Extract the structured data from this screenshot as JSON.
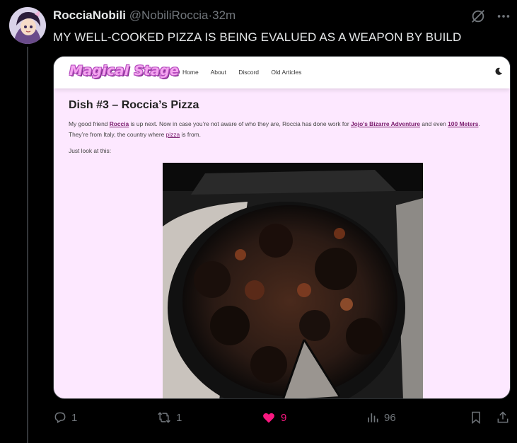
{
  "tweet": {
    "display_name": "RocciaNobili",
    "handle": "@NobiliRoccia",
    "separator": "·",
    "time": "32m",
    "text": "MY WELL-COOKED PIZZA IS BEING EVALUED AS A WEAPON BY BUILD"
  },
  "site": {
    "logo": "Magical Stage",
    "nav": [
      "Home",
      "About",
      "Discord",
      "Old Articles"
    ],
    "article_title": "Dish #3 – Roccia’s Pizza",
    "p1_a": "My good friend ",
    "p1_link1": "Roccia",
    "p1_b": " is up next. Now in case you’re not aware of who they are, Roccia has done work for ",
    "p1_link2": "Jojo’s Bizarre Adventure",
    "p1_c": " and even ",
    "p1_link3": "100 Meters",
    "p1_d": ". They’re from Italy, the country where ",
    "p1_link4": "pizza",
    "p1_e": " is from.",
    "p2": "Just look at this:"
  },
  "actions": {
    "replies": "1",
    "reposts": "1",
    "likes": "9",
    "views": "96"
  },
  "colors": {
    "like": "#f91880",
    "muted": "#71767b",
    "site_bg": "#fde8ff"
  },
  "icons": [
    "grok-icon",
    "more-icon",
    "moon-icon",
    "reply-icon",
    "repost-icon",
    "heart-icon",
    "views-icon",
    "bookmark-icon",
    "share-icon"
  ]
}
